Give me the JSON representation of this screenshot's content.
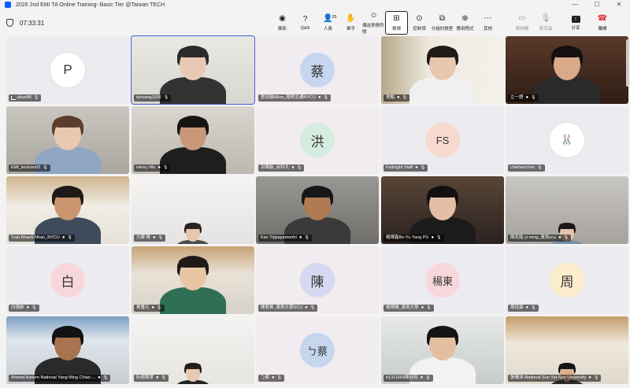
{
  "window": {
    "title": "2026 2nd EMI TA Online Training- Basic Tier @Taiwan TECH"
  },
  "timer": "07:33:31",
  "toolbar": [
    {
      "label": "錄影",
      "icon": "record-icon"
    },
    {
      "label": "Q&A",
      "icon": "qa-icon"
    },
    {
      "label": "人員",
      "icon": "people-icon",
      "count": "25"
    },
    {
      "label": "舉手",
      "icon": "raise-hand-icon"
    },
    {
      "label": "傳送表情符號",
      "icon": "emoji-icon"
    },
    {
      "label": "檢視",
      "icon": "view-icon",
      "active": true
    },
    {
      "label": "控制項",
      "icon": "controls-icon"
    },
    {
      "label": "分組討論室",
      "icon": "breakout-icon"
    },
    {
      "label": "應用程式",
      "icon": "apps-icon"
    },
    {
      "label": "其他",
      "icon": "more-icon"
    }
  ],
  "right_tools": [
    {
      "label": "開相機",
      "icon": "camera-off-icon"
    },
    {
      "label": "麥克風",
      "icon": "mic-off-icon"
    },
    {
      "label": "分享",
      "icon": "share-icon"
    },
    {
      "label": "離開",
      "icon": "leave-icon"
    }
  ],
  "participants": [
    {
      "name": "pilun88",
      "avatar": "P",
      "bg": "#ffffff",
      "signal": true
    },
    {
      "name": "tyhuang1026",
      "video": true
    },
    {
      "name": "楚忠融Miles_陽明交通NYCU",
      "avatar": "蔡",
      "bg": "#c7d6ef",
      "cam": true
    },
    {
      "name": "賀甄",
      "video": true,
      "cam": true
    },
    {
      "name": "立一語",
      "video": true,
      "cam": true
    },
    {
      "name": "EMI_lecturer02",
      "video": true
    },
    {
      "name": "Henry Wu",
      "video": true,
      "cam": true
    },
    {
      "name": "洪賢齡_台科大",
      "avatar": "洪",
      "bg": "#d5ece1",
      "cam": true
    },
    {
      "name": "Fulbright Staff",
      "avatar": "FS",
      "bg": "#f7d9cf",
      "cam": true
    },
    {
      "name": "chiehanchen",
      "avatar": "🐰",
      "bg": "#ffffff"
    },
    {
      "name": "Tran Khanh Nhan_NYCU",
      "video": true,
      "cam": true
    },
    {
      "name": "方霽 陳",
      "video": true,
      "cam": true
    },
    {
      "name": "Kan Tippayamontri",
      "video": true,
      "cam": true
    },
    {
      "name": "楊博鑫Bo-Yu Yang PU",
      "video": true,
      "cam": true
    },
    {
      "name": "陳奕銘 yi ming_東吳scu",
      "video": true,
      "cam": true
    },
    {
      "name": "白慎帥",
      "avatar": "白",
      "bg": "#f7d7dc",
      "cam": true
    },
    {
      "name": "黃璽元",
      "video": true,
      "cam": true
    },
    {
      "name": "陳宥希_東吳大學SCU",
      "avatar": "陳",
      "bg": "#d6d9f1",
      "cam": true
    },
    {
      "name": "楊晴雅_東吳大學",
      "avatar": "楊東",
      "bg": "#f7d7dc",
      "cam": true
    },
    {
      "name": "周佳霖",
      "avatar": "周",
      "bg": "#fbeccb",
      "cam": true
    },
    {
      "name": "Ahmad Azeem-National Yang Ming Chiao ...",
      "video": true,
      "cam": true
    },
    {
      "name": "阮黎蘭翠",
      "video": true,
      "cam": true
    },
    {
      "name": "ㄅ蔡",
      "avatar": "ㄅ蔡",
      "bg": "#c7d6ef",
      "cam": true
    },
    {
      "name": "b1311003陳廷和",
      "video": true,
      "cam": true
    },
    {
      "name": "張雅沐-National Sun Yat-Sen University",
      "video": true,
      "cam": true
    }
  ]
}
